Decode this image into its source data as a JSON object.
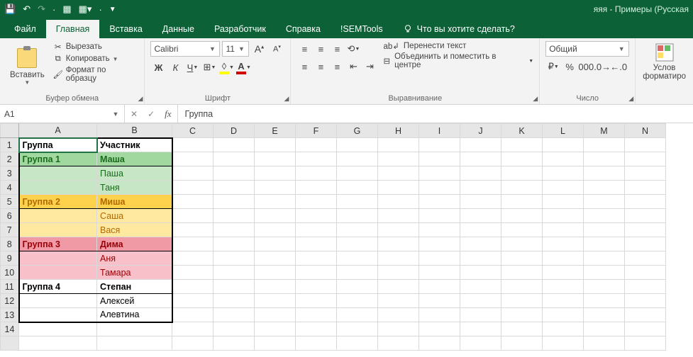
{
  "app": {
    "title": "яяя - Примеры (Русская"
  },
  "qat": {
    "save": "💾",
    "undo": "↶",
    "redo": "↷"
  },
  "tabs": {
    "file": "Файл",
    "home": "Главная",
    "insert": "Вставка",
    "data": "Данные",
    "developer": "Разработчик",
    "help": "Справка",
    "semtools": "!SEMTools",
    "tellme": "Что вы хотите сделать?"
  },
  "ribbon": {
    "clipboard": {
      "paste": "Вставить",
      "cut": "Вырезать",
      "copy": "Копировать",
      "format_painter": "Формат по образцу",
      "group_label": "Буфер обмена"
    },
    "font": {
      "name": "Calibri",
      "size": "11",
      "bold": "Ж",
      "italic": "К",
      "underline": "Ч",
      "inc": "A",
      "dec": "A",
      "group_label": "Шрифт"
    },
    "alignment": {
      "wrap": "Перенести текст",
      "merge": "Объединить и поместить в центре",
      "group_label": "Выравнивание"
    },
    "number": {
      "format": "Общий",
      "group_label": "Число"
    },
    "cond": {
      "label_1": "Услов",
      "label_2": "форматиро"
    }
  },
  "formula_bar": {
    "cell_ref": "A1",
    "value": "Группа"
  },
  "columns": [
    "A",
    "B",
    "C",
    "D",
    "E",
    "F",
    "G",
    "H",
    "I",
    "J",
    "K",
    "L",
    "M",
    "N"
  ],
  "sheet": {
    "h_a": "Группа",
    "h_b": "Участник",
    "g1": "Группа 1",
    "g1_p1": "Маша",
    "g1_p2": "Паша",
    "g1_p3": "Таня",
    "g2": "Группа 2",
    "g2_p1": "Миша",
    "g2_p2": "Саша",
    "g2_p3": "Вася",
    "g3": "Группа 3",
    "g3_p1": "Дима",
    "g3_p2": "Аня",
    "g3_p3": "Тамара",
    "g4": "Группа 4",
    "g4_p1": "Степан",
    "g4_p2": "Алексей",
    "g4_p3": "Алевтина"
  }
}
